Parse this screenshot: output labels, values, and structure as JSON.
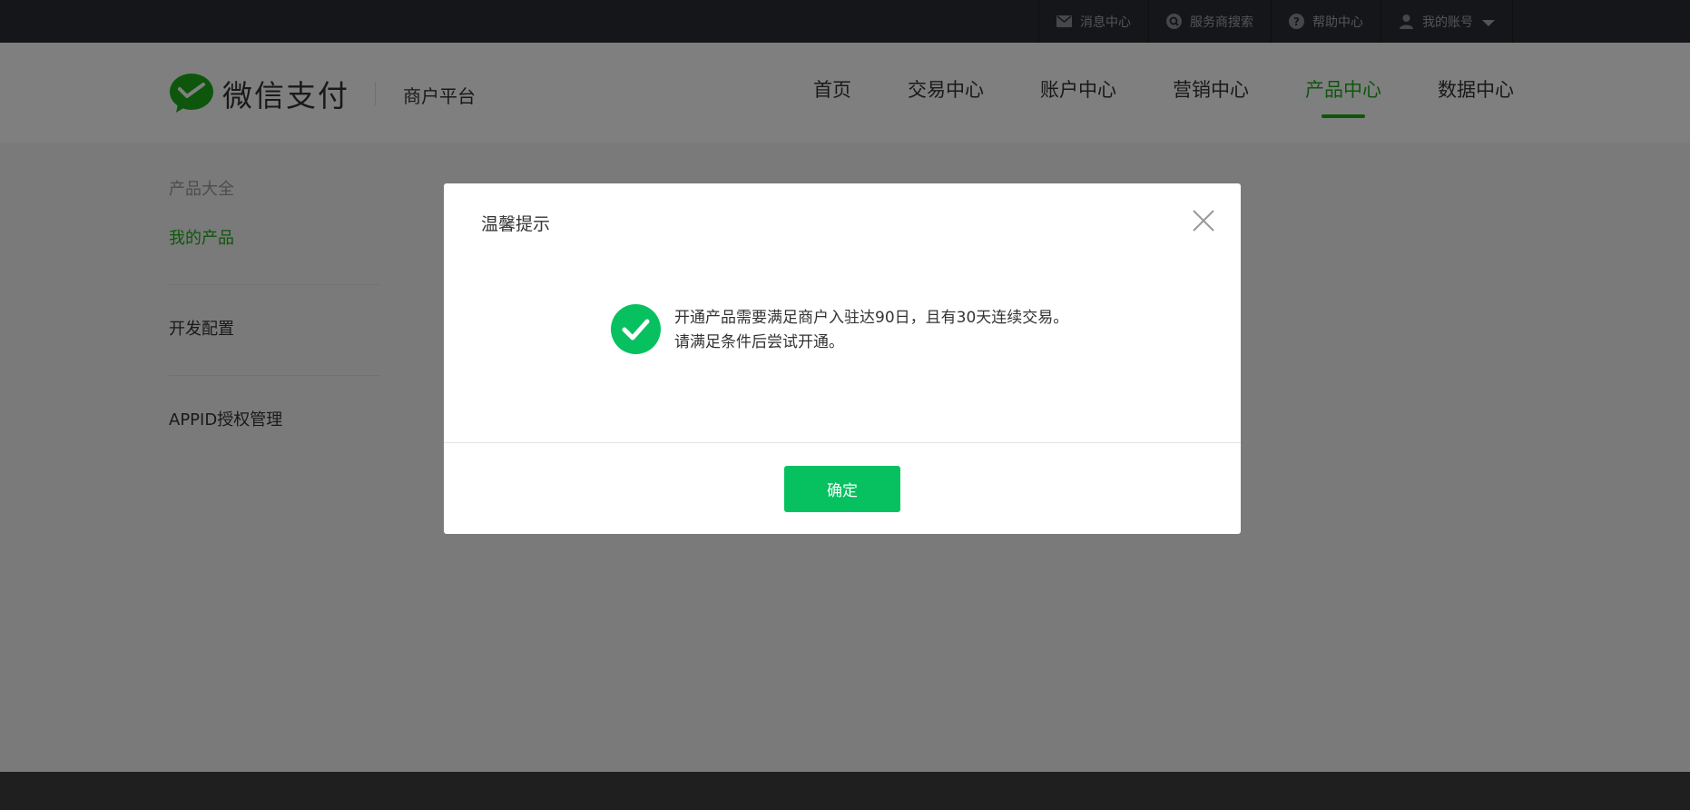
{
  "topbar": {
    "items": [
      {
        "label": "消息中心",
        "icon": "mail-icon"
      },
      {
        "label": "服务商搜索",
        "icon": "search-icon"
      },
      {
        "label": "帮助中心",
        "icon": "help-icon"
      },
      {
        "label": "我的账号",
        "icon": "user-icon"
      }
    ]
  },
  "header": {
    "logo_text": "微信支付",
    "subtitle": "商户平台",
    "nav": [
      {
        "label": "首页"
      },
      {
        "label": "交易中心"
      },
      {
        "label": "账户中心"
      },
      {
        "label": "营销中心"
      },
      {
        "label": "产品中心",
        "active": true
      },
      {
        "label": "数据中心"
      }
    ]
  },
  "sidebar": {
    "group_title": "产品大全",
    "active_item": "我的产品",
    "items": [
      "开发配置",
      "APPID授权管理"
    ]
  },
  "dialog": {
    "title": "温馨提示",
    "message_line1": "开通产品需要满足商户入驻达90日，且有30天连续交易。",
    "message_line2": "请满足条件后尝试开通。",
    "confirm_label": "确定"
  },
  "colors": {
    "brand_green": "#1aad19",
    "button_green": "#07c160",
    "topbar_bg": "#2b2d33",
    "overlay": "rgba(0,0,0,0.5)"
  }
}
